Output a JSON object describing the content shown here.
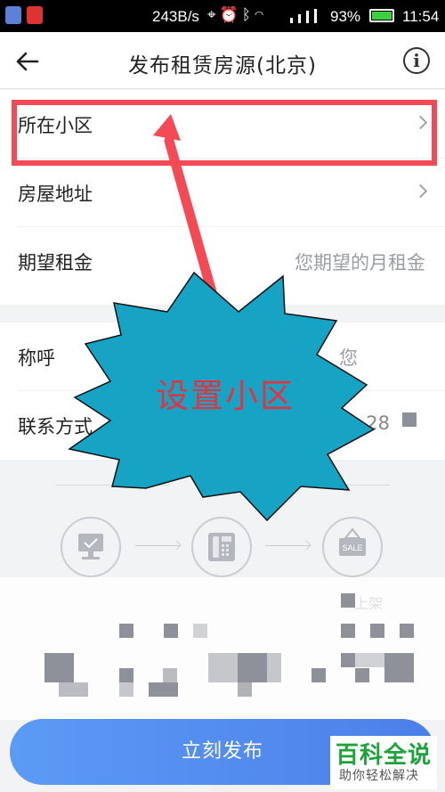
{
  "status_bar": {
    "network_speed": "243B/s",
    "battery_percent": "93%",
    "time": "11:54",
    "icons": [
      "shield-app-icon",
      "qq-app-icon",
      "location-icon",
      "alarm-icon",
      "bluetooth-icon",
      "wifi-icon",
      "signal-icon",
      "battery-icon"
    ]
  },
  "header": {
    "title": "发布租赁房源(北京)",
    "back_icon": "arrow-left-icon",
    "info_icon": "info-icon"
  },
  "form": {
    "group_1": [
      {
        "label": "所在小区",
        "accessory": "chevron-right-icon"
      },
      {
        "label": "房屋地址",
        "accessory": "chevron-right-icon"
      },
      {
        "label": "期望租金",
        "placeholder": "您期望的月租金"
      }
    ],
    "group_2": [
      {
        "label": "称呼",
        "placeholder_fragment": "您"
      },
      {
        "label": "联系方式",
        "value_fragment": "28"
      }
    ]
  },
  "annotation": {
    "callout_text": "设置小区",
    "highlight_color": "#f44a55",
    "callout_color": "#16a3c4"
  },
  "steps": {
    "third_label_fragment": "上架",
    "icons": [
      "monitor-check-icon",
      "phone-icon",
      "sale-tag-icon"
    ],
    "sale_tag_text": "SALE"
  },
  "actions": {
    "publish_label": "立刻发布",
    "publish_color": "#4c7fe9"
  },
  "watermark": {
    "title": "百科全说",
    "subtitle": "助你轻松解决"
  }
}
